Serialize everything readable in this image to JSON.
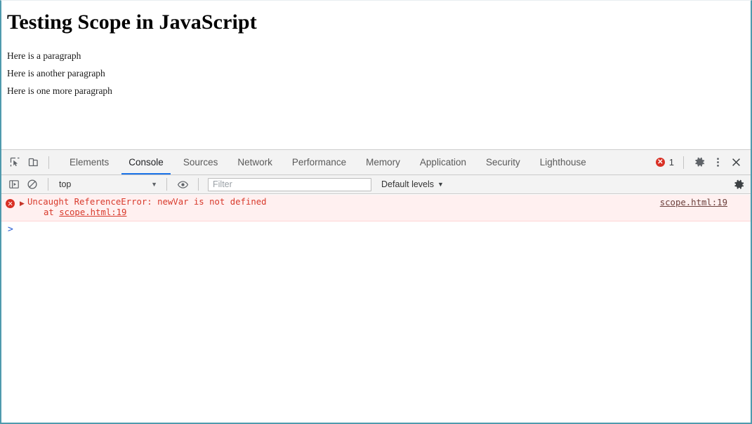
{
  "page": {
    "title": "Testing Scope in JavaScript",
    "paragraphs": [
      "Here is a paragraph",
      "Here is another paragraph",
      "Here is one more paragraph"
    ]
  },
  "devtools": {
    "left_controls": [
      {
        "name": "inspect-element-icon",
        "label": "Inspect element"
      },
      {
        "name": "device-toolbar-icon",
        "label": "Toggle device toolbar"
      }
    ],
    "tabs": [
      {
        "label": "Elements",
        "active": false
      },
      {
        "label": "Console",
        "active": true
      },
      {
        "label": "Sources",
        "active": false
      },
      {
        "label": "Network",
        "active": false
      },
      {
        "label": "Performance",
        "active": false
      },
      {
        "label": "Memory",
        "active": false
      },
      {
        "label": "Application",
        "active": false
      },
      {
        "label": "Security",
        "active": false
      },
      {
        "label": "Lighthouse",
        "active": false
      }
    ],
    "error_badge": {
      "count": "1",
      "color": "#d93025"
    },
    "right_controls": [
      {
        "name": "settings-gear-icon",
        "label": "Settings"
      },
      {
        "name": "more-options-icon",
        "label": "Customize and control DevTools"
      },
      {
        "name": "close-devtools-icon",
        "label": "Close DevTools"
      }
    ],
    "filterbar": {
      "sidebar_toggle": "Show console sidebar",
      "clear_console": "Clear console",
      "context": "top",
      "context_caret": "▼",
      "live_expression": "Create live expression",
      "filter_value": "",
      "filter_placeholder": "Filter",
      "levels_label": "Default levels",
      "levels_caret": "▼",
      "settings": "Console settings"
    },
    "console": {
      "messages": [
        {
          "type": "error",
          "disclosure": "▶",
          "text": "Uncaught ReferenceError: newVar is not defined",
          "stack_prefix": "    at ",
          "stack_link": "scope.html:19",
          "source_link": "scope.html:19"
        }
      ],
      "prompt_caret": ">",
      "prompt_value": ""
    }
  },
  "colors": {
    "accent": "#1a73e8",
    "error": "#d93025",
    "error_text": "#d8392b",
    "error_bg": "#fff0f0",
    "toolbar_bg": "#f3f3f3",
    "window_border": "#4f9aad"
  }
}
